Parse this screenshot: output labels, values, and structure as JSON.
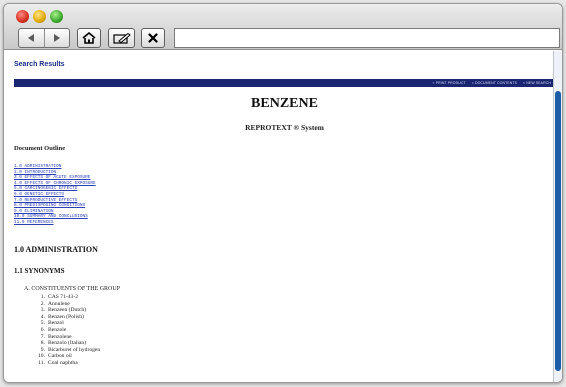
{
  "browser": {
    "back_label": "back",
    "forward_label": "forward",
    "home_icon": "home-icon",
    "edit_icon": "edit-icon",
    "close_icon": "close-icon",
    "address_value": ""
  },
  "page": {
    "search_results_link": "Search Results",
    "nav_links": [
      "< PRINT PRODUCT",
      "< DOCUMENT CONTENTS",
      "< NEW SEARCH"
    ],
    "title": "BENZENE",
    "subtitle": "REPROTEXT ® System",
    "outline_heading": "Document Outline",
    "outline_items": [
      "1.0 ADMINISTRATION",
      "2.0 INTRODUCTION",
      "3.0 EFFECTS OF ACUTE EXPOSURE",
      "4.0 EFFECTS OF CHRONIC EXPOSURE",
      "5.0 CARCINOGENIC EFFECTS",
      "6.0 GENETIC EFFECTS",
      "7.0 REPRODUCTIVE EFFECTS",
      "8.0 PREDISPOSING CONDITIONS",
      "9.0 ELIMINATION",
      "10.0 SUMMARY AND CONCLUSIONS",
      "11.0 REFERENCES"
    ],
    "section_admin": "1.0 ADMINISTRATION",
    "section_synonyms": "1.1 SYNONYMS",
    "group_label": "A. CONSTITUENTS OF THE GROUP",
    "synonyms": [
      {
        "num": "1.",
        "text": "CAS 71-43-2"
      },
      {
        "num": "2.",
        "text": "Annulene"
      },
      {
        "num": "3.",
        "text": "Benzeen (Dutch)"
      },
      {
        "num": "4.",
        "text": "Benzen (Polish)"
      },
      {
        "num": "5.",
        "text": "Benzol"
      },
      {
        "num": "6.",
        "text": "Benzole"
      },
      {
        "num": "7.",
        "text": "Benzolene"
      },
      {
        "num": "8.",
        "text": "Benzolo (Italian)"
      },
      {
        "num": "9.",
        "text": "Bicarburet of hydrogen"
      },
      {
        "num": "10.",
        "text": "Carbon oil"
      },
      {
        "num": "11.",
        "text": "Coal naphtha"
      }
    ]
  },
  "colors": {
    "navbar": "#1a2672",
    "link": "#2a3fb8",
    "scroll_thumb": "#1c5fa8"
  }
}
